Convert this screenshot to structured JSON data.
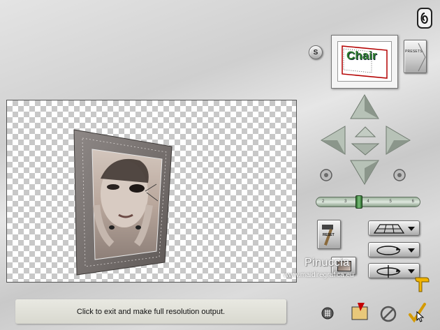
{
  "status": {
    "message": "Click to exit and make full resolution output."
  },
  "presets": {
    "label": "PRESETS",
    "thumbnail_text": "Chair"
  },
  "reset": {
    "label": "RESET"
  },
  "s_button": {
    "label": "S"
  },
  "zoom": {
    "tick_labels": [
      "2",
      "3",
      "4",
      "5",
      "6"
    ],
    "level": 0.4
  },
  "watermark": {
    "title": "Pinuccia",
    "url": "www.maidiregrafica.eu"
  },
  "icons": {
    "logo": "spiral-logo-icon",
    "up": "arrow-up-icon",
    "down": "arrow-down-icon",
    "left": "arrow-left-icon",
    "right": "arrow-right-icon",
    "rotate_ccw": "rotate-ccw-icon",
    "rotate_cw": "rotate-cw-icon",
    "grid": "grid-icon",
    "export": "export-icon",
    "cancel": "cancel-icon",
    "ok": "ok-checkmark-icon",
    "pointer": "pointing-hand-icon"
  },
  "colors": {
    "background": "#d6d6d6",
    "checker_dark": "#c8c8c8",
    "status_bg": "#e2e2da",
    "zoom_green": "#3f8f3f"
  }
}
